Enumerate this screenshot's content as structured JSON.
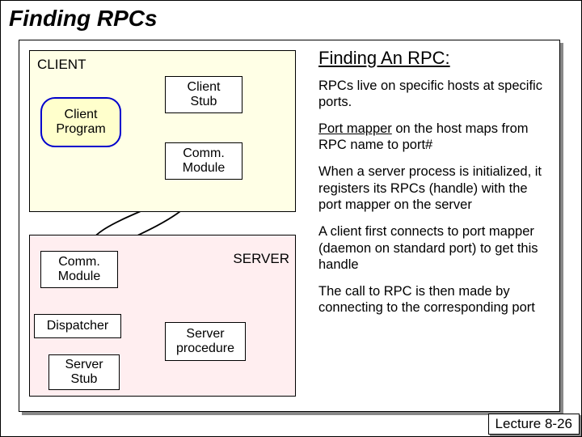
{
  "title": "Finding RPCs",
  "diagram": {
    "client_panel_label": "CLIENT",
    "client_program": "Client\nProgram",
    "client_stub": "Client\nStub",
    "comm_module_top": "Comm.\nModule",
    "server_panel_label": "SERVER",
    "comm_module_bottom": "Comm.\nModule",
    "dispatcher": "Dispatcher",
    "server_stub": "Server\nStub",
    "server_proc": "Server\nprocedure"
  },
  "text": {
    "heading": "Finding An RPC:",
    "p1": "RPCs live on specific hosts at specific ports.",
    "p2_pre": "",
    "p2_u": "Port mapper",
    "p2_post": " on the host maps from RPC name to port#",
    "p3": "When a server process is initialized, it registers its RPCs (handle) with the port mapper  on the server",
    "p4": "A client first connects to port mapper (daemon on standard port) to get this handle",
    "p5": "The call to RPC is then made by connecting to the corresponding port"
  },
  "lecture_tag": "Lecture 8-26"
}
